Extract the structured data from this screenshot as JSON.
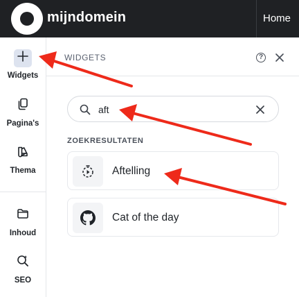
{
  "topbar": {
    "brand": "mijndomein",
    "home_label": "Home"
  },
  "sidebar": {
    "items": [
      {
        "label": "Widgets",
        "icon": "plus-icon",
        "active": true
      },
      {
        "label": "Pagina's",
        "icon": "pages-icon",
        "active": false
      },
      {
        "label": "Thema",
        "icon": "palette-icon",
        "active": false
      },
      {
        "label": "Inhoud",
        "icon": "folder-icon",
        "active": false
      },
      {
        "label": "SEO",
        "icon": "seo-search-icon",
        "active": false
      }
    ]
  },
  "panel": {
    "title": "WIDGETS",
    "help_glyph": "?",
    "search": {
      "value": "aft",
      "placeholder": ""
    },
    "results_heading": "ZOEKRESULTATEN",
    "results": [
      {
        "label": "Aftelling",
        "icon": "countdown-timer-icon"
      },
      {
        "label": "Cat of the day",
        "icon": "github-icon"
      }
    ]
  },
  "annotations": {
    "arrow_color": "#ee2a1a",
    "arrow_count": 3
  },
  "colors": {
    "topbar_bg": "#1f2124",
    "active_icon_bg": "#dde3ef",
    "border": "#e4e6ea",
    "arrow": "#ee2a1a"
  }
}
